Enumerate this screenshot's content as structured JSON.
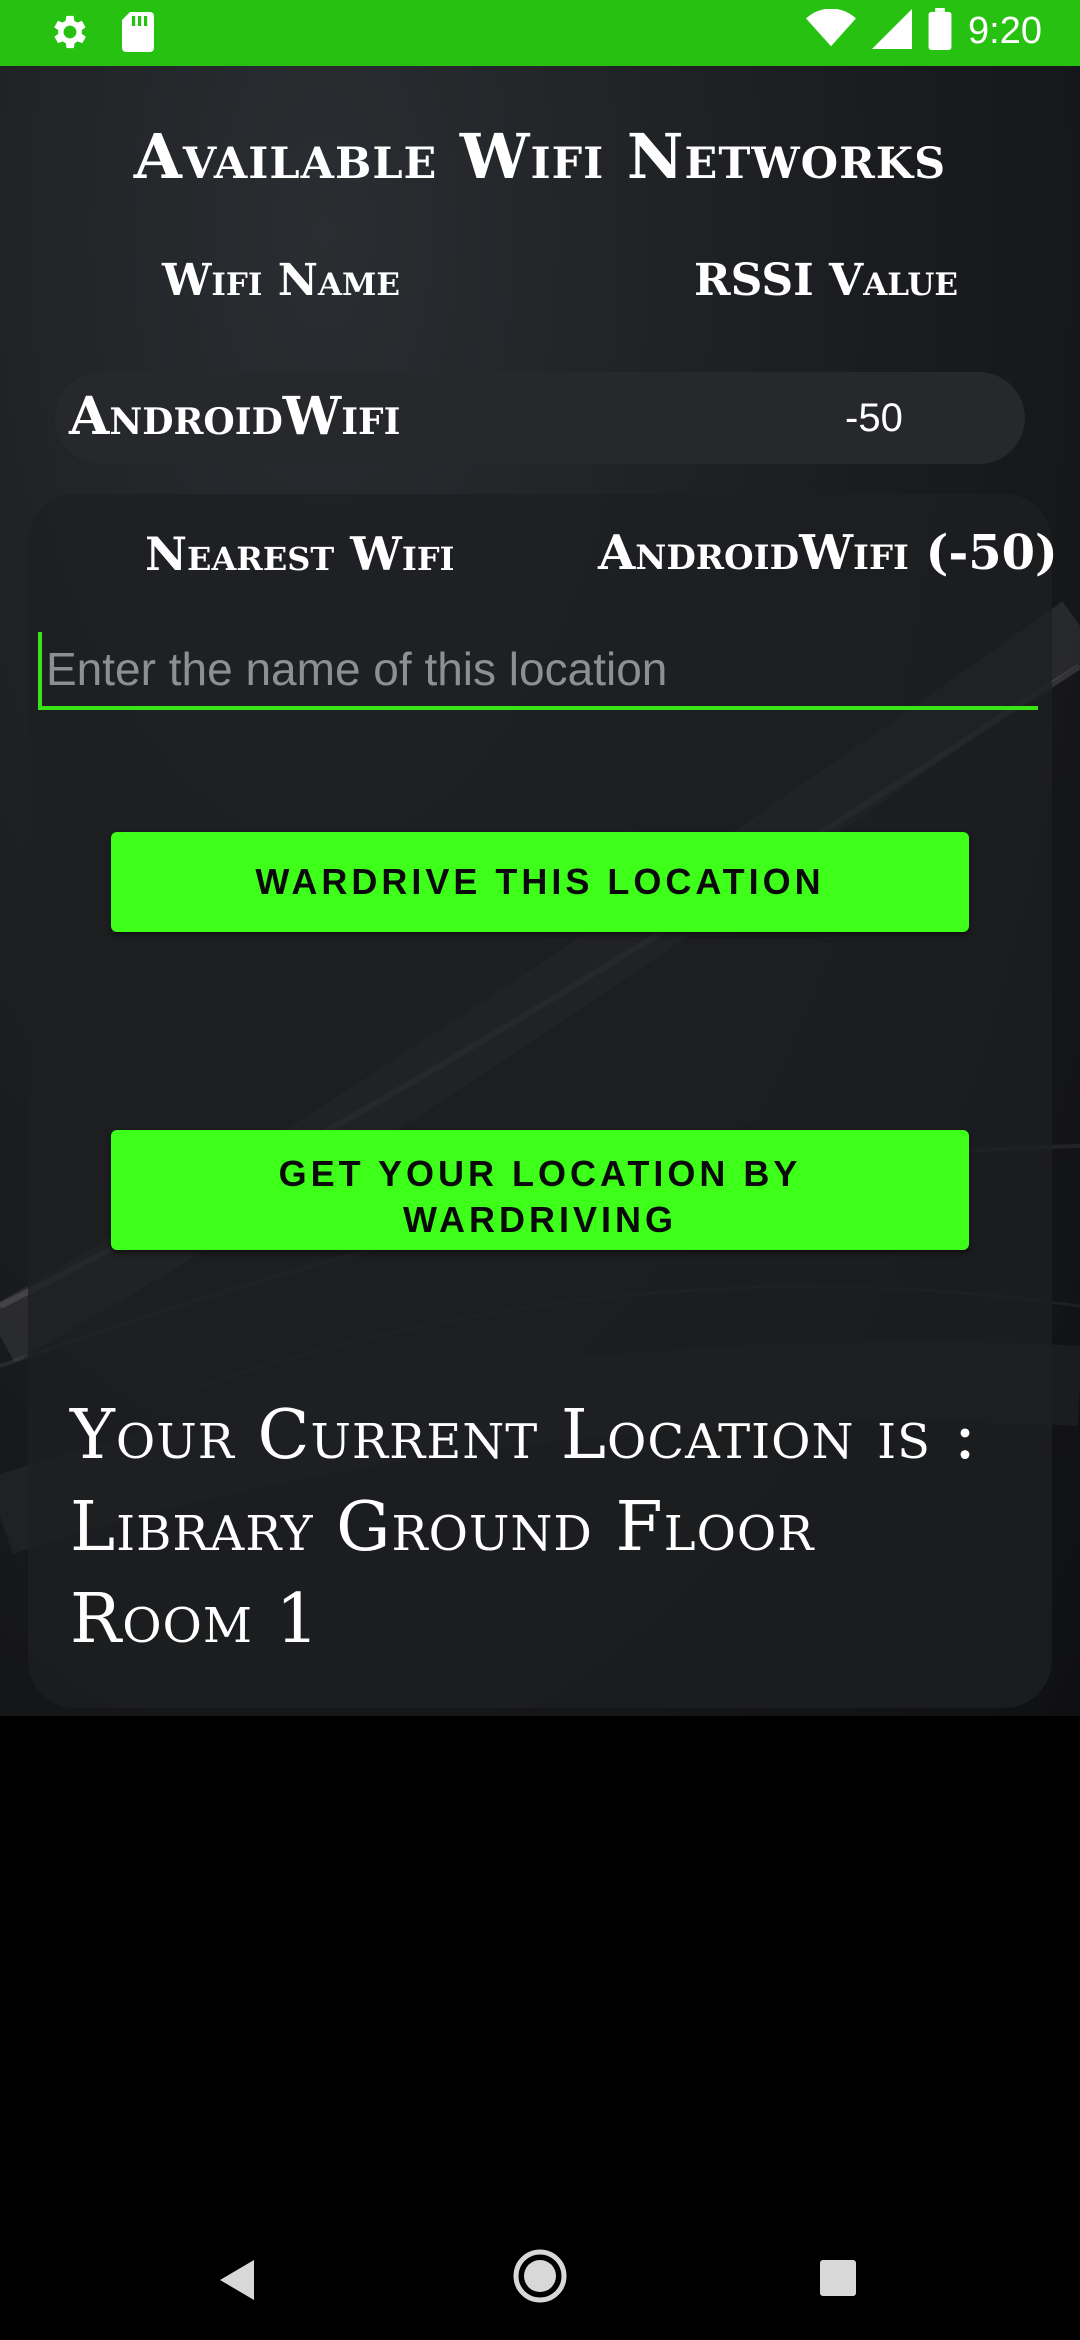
{
  "status_bar": {
    "time": "9:20",
    "left_icons": [
      "gear-icon",
      "sd-card-icon"
    ],
    "right_icons": [
      "wifi-icon",
      "signal-icon",
      "battery-icon"
    ],
    "color": "#27c211"
  },
  "header": {
    "title": "Available Wifi Networks"
  },
  "columns": {
    "name_label": "Wifi Name",
    "rssi_label": "RSSI Value"
  },
  "networks": [
    {
      "name": "AndroidWifi",
      "rssi": "-50"
    }
  ],
  "panel": {
    "nearest_label": "Nearest Wifi",
    "nearest_value": "AndroidWifi (-50)",
    "location_input": {
      "value": "",
      "placeholder": "Enter the name of this location"
    },
    "wardrive_button": "WARDRIVE THIS LOCATION",
    "get_location_button": "GET YOUR LOCATION BY WARDRIVING",
    "current_location": "Your Current Location is : Library Ground Floor Room 1"
  },
  "nav_bar": {
    "icons": [
      "back-icon",
      "home-icon",
      "recents-icon"
    ]
  },
  "colors": {
    "accent": "#3dff1a",
    "status_bar": "#27c211",
    "background": "#1c1e21"
  }
}
